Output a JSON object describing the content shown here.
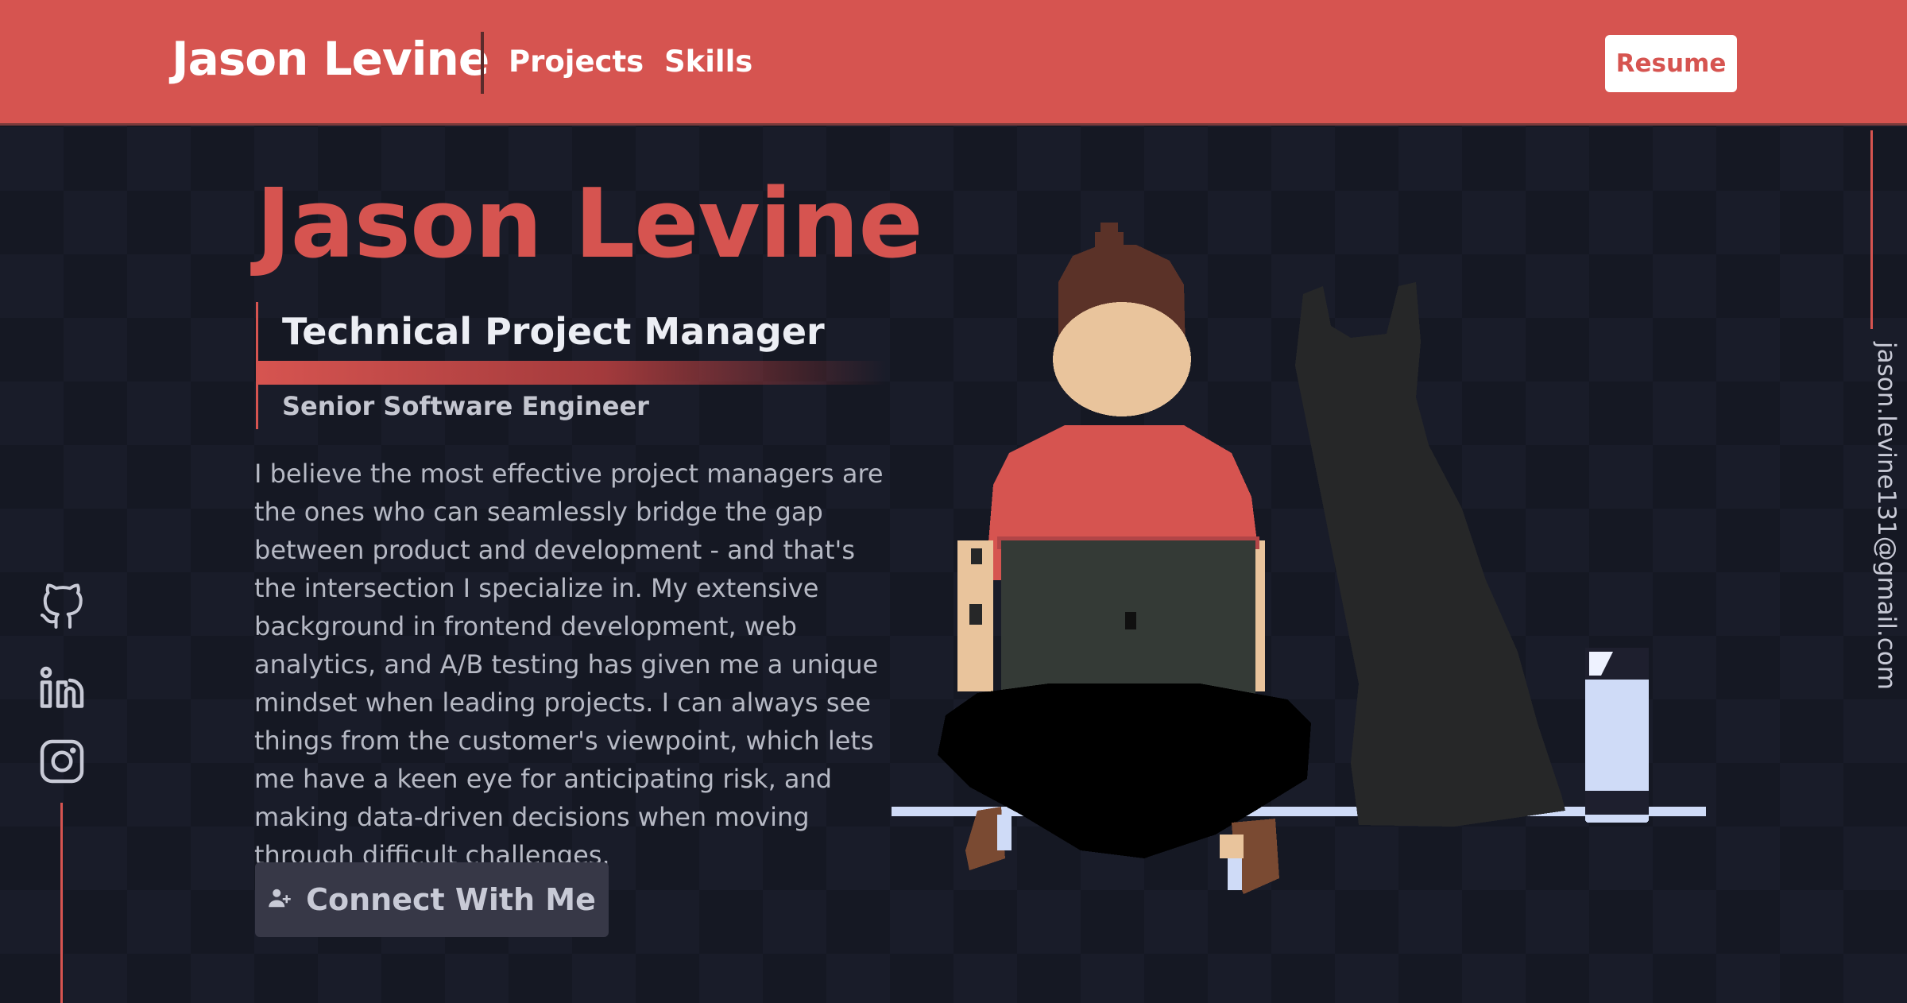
{
  "header": {
    "brand": "Jason Levine",
    "nav": [
      "Projects",
      "Skills"
    ],
    "resume_label": "Resume"
  },
  "hero": {
    "name": "Jason Levine",
    "title_primary": "Technical Project Manager",
    "title_secondary": "Senior Software Engineer",
    "bio": "I believe the most effective project managers are the ones who can seamlessly bridge the gap between product and development - and that's the intersection I specialize in. My extensive background in frontend development, web analytics, and A/B testing has given me a unique mindset when leading projects. I can always see things from the customer's viewpoint, which lets me have a keen eye for anticipating risk, and making data-driven decisions when moving through difficult challenges.",
    "connect_label": "Connect With Me",
    "connect_icon": "user-plus-icon"
  },
  "social": [
    {
      "icon": "github-icon"
    },
    {
      "icon": "linkedin-icon"
    },
    {
      "icon": "instagram-icon"
    }
  ],
  "contact": {
    "email": "jason.levine131@gmail.com"
  },
  "colors": {
    "accent": "#d65450",
    "background": "#191c29",
    "button_bg": "#373847",
    "text_light": "#eceef4"
  }
}
